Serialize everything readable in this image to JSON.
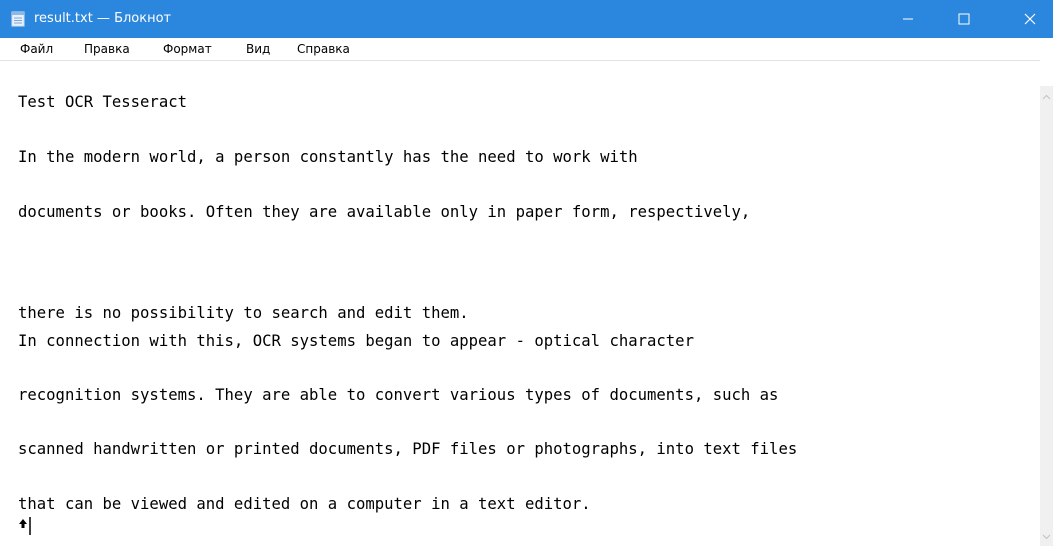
{
  "window": {
    "title": "result.txt — Блокнот",
    "titlebar_color": "#2b87dd"
  },
  "controls": {
    "minimize_icon": "minimize-icon",
    "maximize_icon": "maximize-icon",
    "close_icon": "close-icon"
  },
  "menu": {
    "items": [
      {
        "label": "Файл"
      },
      {
        "label": "Правка"
      },
      {
        "label": "Формат"
      },
      {
        "label": "Вид"
      },
      {
        "label": "Справка"
      }
    ]
  },
  "editor": {
    "lines": [
      "Test OCR Tesseract",
      "In the modern world, a person constantly has the need to work with",
      "documents or books. Often they are available only in paper form, respectively,",
      "there is no possibility to search and edit them.",
      "In connection with this, OCR systems began to appear - optical character",
      "recognition systems. They are able to convert various types of documents, such as",
      "scanned handwritten or printed documents, PDF files or photographs, into text files",
      "that can be viewed and edited on a computer in a text editor."
    ]
  }
}
